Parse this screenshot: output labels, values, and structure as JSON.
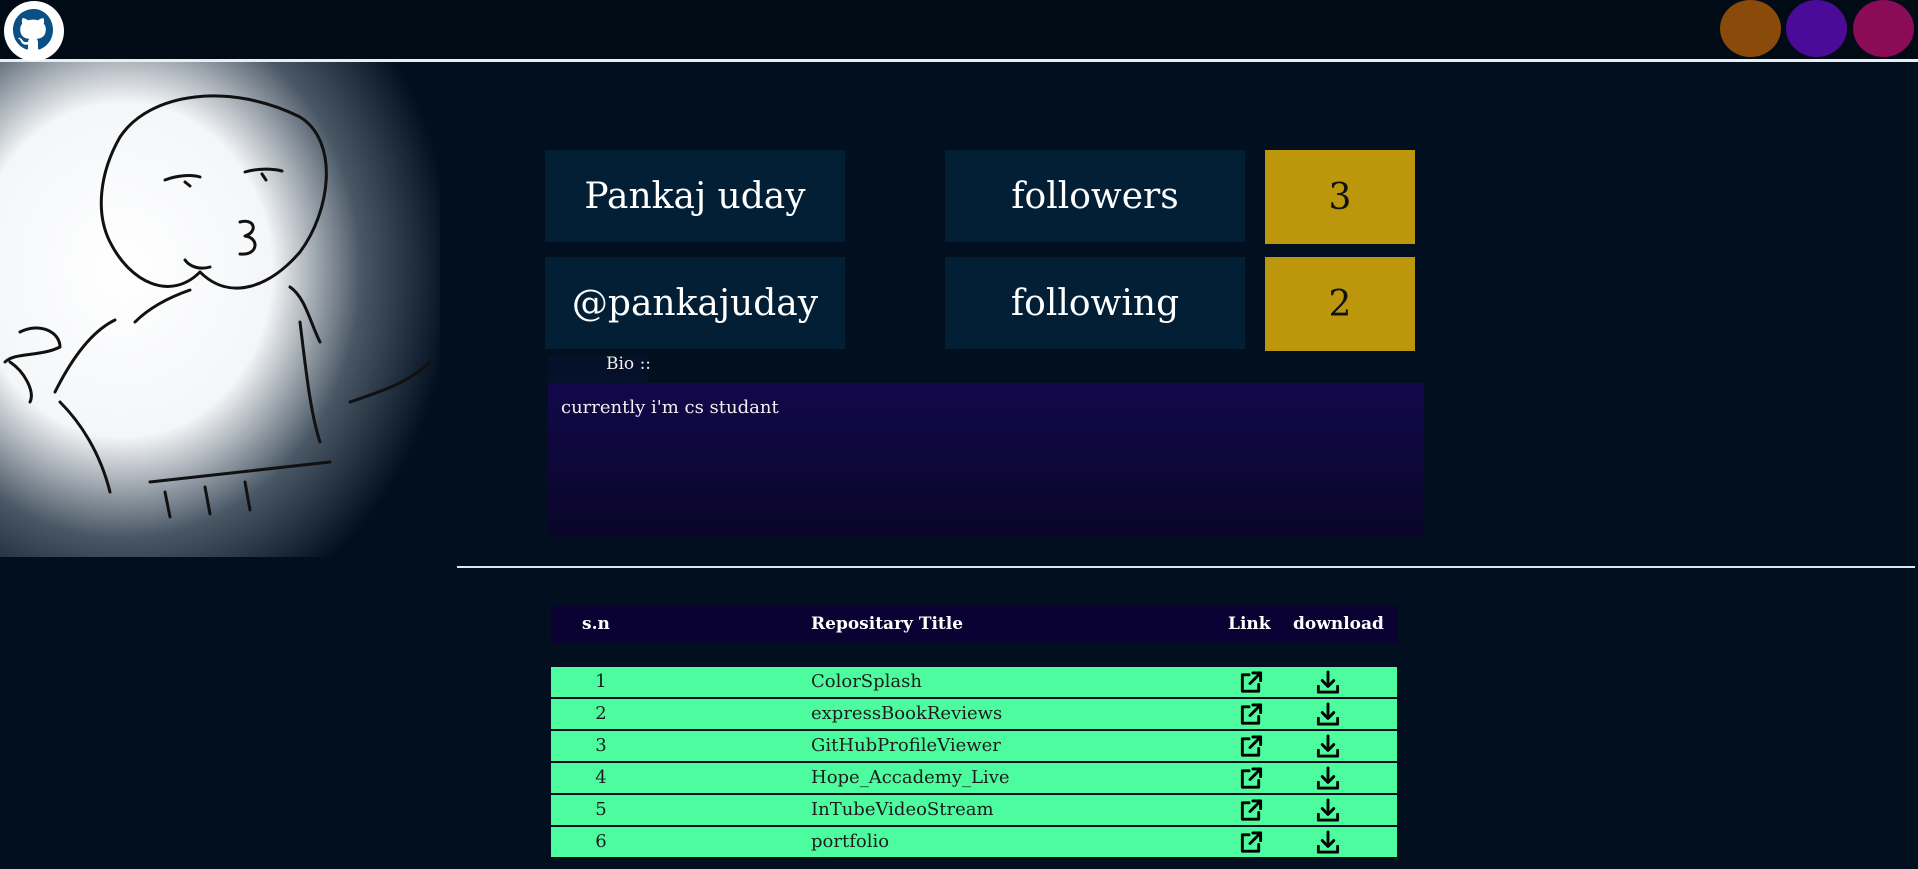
{
  "profile": {
    "name": "Pankaj uday",
    "username": "@pankajuday",
    "followers_label": "followers",
    "followers_count": "3",
    "following_label": "following",
    "following_count": "2",
    "bio_label": "Bio ::",
    "bio": "currently i'm cs studant"
  },
  "theme_colors": [
    "#8a4a09",
    "#4b0b99",
    "#8a0b56"
  ],
  "table": {
    "headers": [
      "s.n",
      "Repositary Title",
      "Link",
      "download"
    ],
    "rows": [
      {
        "sn": "1",
        "title": "ColorSplash"
      },
      {
        "sn": "2",
        "title": "expressBookReviews"
      },
      {
        "sn": "3",
        "title": "GitHubProfileViewer"
      },
      {
        "sn": "4",
        "title": "Hope_Accademy_Live"
      },
      {
        "sn": "5",
        "title": "InTubeVideoStream"
      },
      {
        "sn": "6",
        "title": "portfolio"
      }
    ],
    "link_icon": "external-link-icon",
    "download_icon": "download-icon"
  },
  "icons": {
    "logo": "github-octocat-icon"
  }
}
